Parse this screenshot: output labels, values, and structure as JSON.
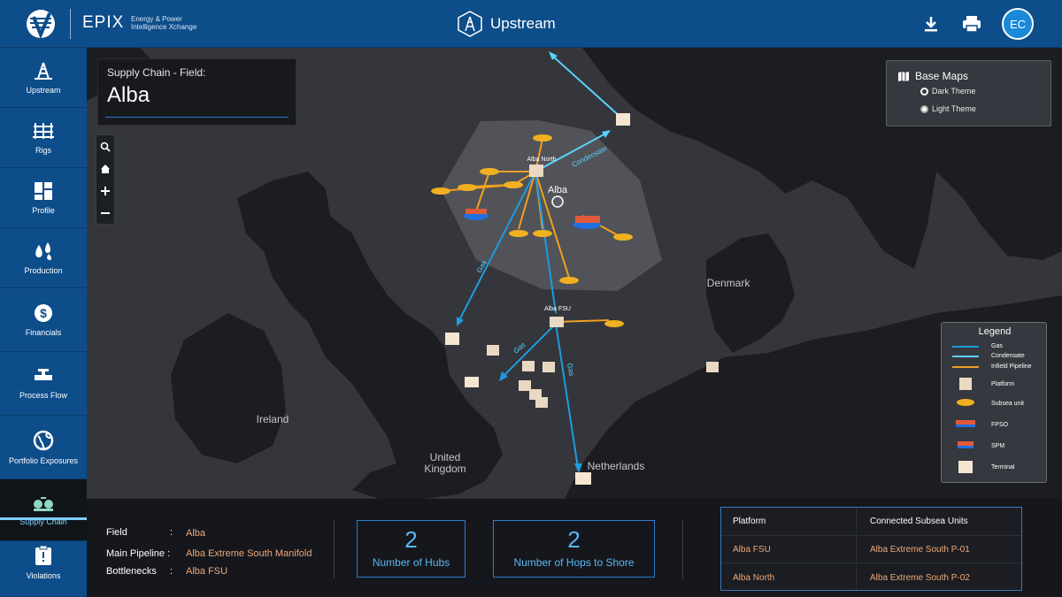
{
  "header": {
    "brand": "EPIX",
    "brand_sub": "Energy & Power Intelligence Xchange",
    "module_title": "Upstream",
    "avatar_initials": "EC",
    "accent": "#0d4d8a"
  },
  "sidebar": {
    "items": [
      {
        "label": "Upstream",
        "icon": "oil-derrick-icon"
      },
      {
        "label": "Rigs",
        "icon": "rig-icon"
      },
      {
        "label": "Profile",
        "icon": "dashboard-grid-icon"
      },
      {
        "label": "Production",
        "icon": "droplets-icon"
      },
      {
        "label": "Financials",
        "icon": "dollar-icon"
      },
      {
        "label": "Process Flow",
        "icon": "valve-icon"
      },
      {
        "label": "Portfolio Exposures",
        "icon": "globe-icon"
      },
      {
        "label": "Supply Chain",
        "icon": "supply-chain-icon",
        "active": true
      },
      {
        "label": "Violations",
        "icon": "clipboard-alert-icon"
      }
    ]
  },
  "field_card": {
    "label": "Supply Chain - Field:",
    "value": "Alba"
  },
  "base_maps": {
    "title": "Base Maps",
    "options": [
      "Dark Theme",
      "Light Theme"
    ],
    "selected": "Dark Theme"
  },
  "map": {
    "field_marker_label": "Alba",
    "labels": {
      "alba_north": "Alba North",
      "alba_fsu": "Alba FSU",
      "ireland": "Ireland",
      "uk_line1": "United",
      "uk_line2": "Kingdom",
      "denmark": "Denmark",
      "netherlands": "Netherlands",
      "condensate": "Condensate",
      "gas1": "Gas",
      "gas2": "Gas",
      "gas3": "Gas"
    },
    "colors": {
      "gas": "#1e9be0",
      "condensate": "#5ad2ff",
      "infield": "#f0a020"
    }
  },
  "legend": {
    "title": "Legend",
    "items": [
      "Gas",
      "Condensate",
      "Infield Pipeline",
      "Platform",
      "Subsea unit",
      "FPSO",
      "SPM",
      "Terminal"
    ]
  },
  "summary": {
    "field_label": "Field",
    "field_value": "Alba",
    "pipeline_label": "Main Pipeline :",
    "pipeline_value": "Alba Extreme South Manifold",
    "bottlenecks_label": "Bottlenecks",
    "bottlenecks_value": "Alba FSU",
    "colon": ":"
  },
  "stats": [
    {
      "value": "2",
      "label": "Number of Hubs"
    },
    {
      "value": "2",
      "label": "Number of Hops to Shore"
    }
  ],
  "table": {
    "headers": [
      "Platform",
      "Connected Subsea Units"
    ],
    "rows": [
      [
        "Alba FSU",
        "Alba Extreme South P-01"
      ],
      [
        "Alba North",
        "Alba Extreme South P-02"
      ]
    ]
  }
}
